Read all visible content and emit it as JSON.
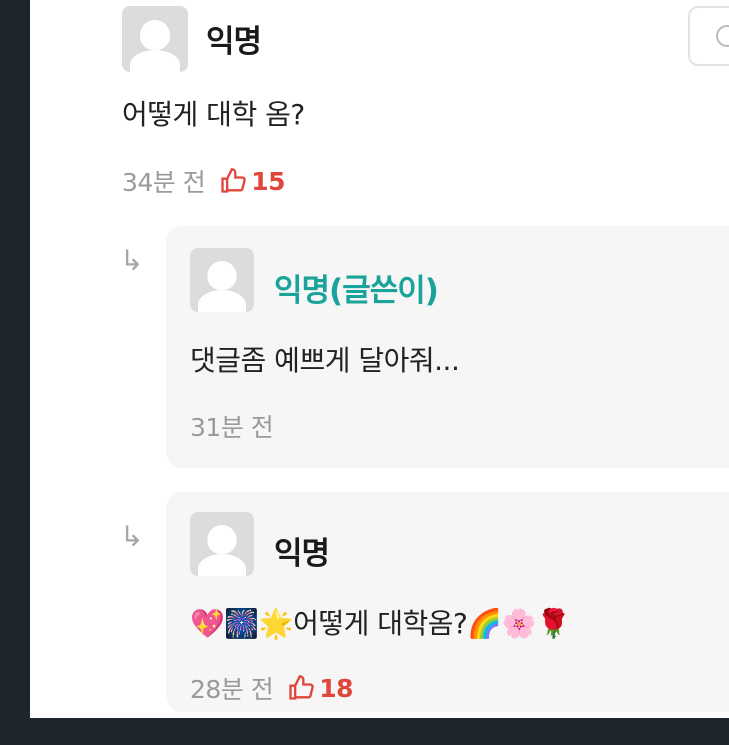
{
  "comment": {
    "author": "익명",
    "text": "어떻게 대학 옴?",
    "time": "34분 전",
    "likes": "15"
  },
  "replies": [
    {
      "author": "익명(글쓴이)",
      "text": "댓글좀 예쁘게 달아줘...",
      "time": "31분 전"
    },
    {
      "author": "익명",
      "emoji_prefix": "💖🎆🌟",
      "text": "어떻게 대학옴?",
      "emoji_suffix": "🌈🌸🌹",
      "time": "28분 전",
      "likes": "18"
    }
  ],
  "icons": {
    "reply_arrow": "↳",
    "like": "thumbs-up-icon",
    "comment_action": "comment-icon"
  },
  "colors": {
    "author_highlight": "#1aa39a",
    "like": "#e0463a"
  }
}
